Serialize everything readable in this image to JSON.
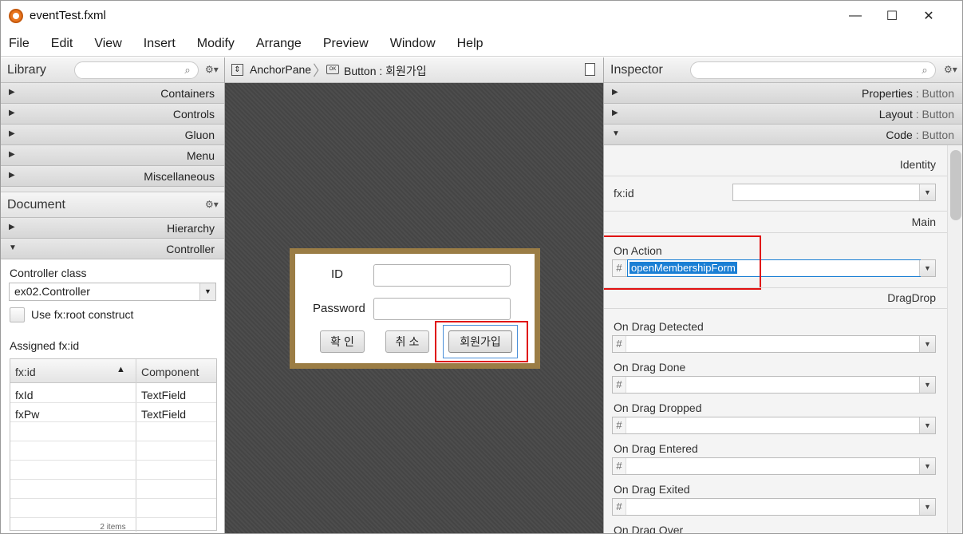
{
  "window": {
    "title": "eventTest.fxml",
    "minimize": "—",
    "maximize": "☐",
    "close": "✕"
  },
  "menu": [
    "File",
    "Edit",
    "View",
    "Insert",
    "Modify",
    "Arrange",
    "Preview",
    "Window",
    "Help"
  ],
  "library": {
    "title": "Library",
    "search_icon": "search-icon",
    "sections": [
      "Containers",
      "Controls",
      "Gluon",
      "Menu",
      "Miscellaneous"
    ]
  },
  "document": {
    "title": "Document",
    "sections": [
      "Hierarchy",
      "Controller"
    ],
    "controller_class_label": "Controller class",
    "controller_class_value": "ex02.Controller",
    "use_root_label": "Use fx:root construct",
    "assigned_label": "Assigned fx:id",
    "table": {
      "headers": [
        "fx:id",
        "Component"
      ],
      "rows": [
        [
          "fxId",
          "TextField"
        ],
        [
          "fxPw",
          "TextField"
        ]
      ],
      "footer": "2 items"
    }
  },
  "breadcrumb": {
    "anchor": "AnchorPane",
    "button": "Button : 회원가입"
  },
  "form": {
    "id_label": "ID",
    "pw_label": "Password",
    "buttons": [
      "확 인",
      "취 소",
      "회원가입"
    ]
  },
  "inspector": {
    "title": "Inspector",
    "sections": [
      {
        "label": "Properties",
        "sub": ": Button"
      },
      {
        "label": "Layout",
        "sub": ": Button"
      },
      {
        "label": "Code",
        "sub": ": Button"
      }
    ],
    "identity": "Identity",
    "fxid_label": "fx:id",
    "main": "Main",
    "on_action_label": "On Action",
    "on_action_value": "openMembershipForm",
    "dragdrop": "DragDrop",
    "drag_labels": [
      "On Drag Detected",
      "On Drag Done",
      "On Drag Dropped",
      "On Drag Entered",
      "On Drag Exited",
      "On Drag Over"
    ]
  },
  "colors": {
    "highlight": "#1a7fd4",
    "annotation": "#e01010",
    "form_border": "#9b7d45"
  }
}
